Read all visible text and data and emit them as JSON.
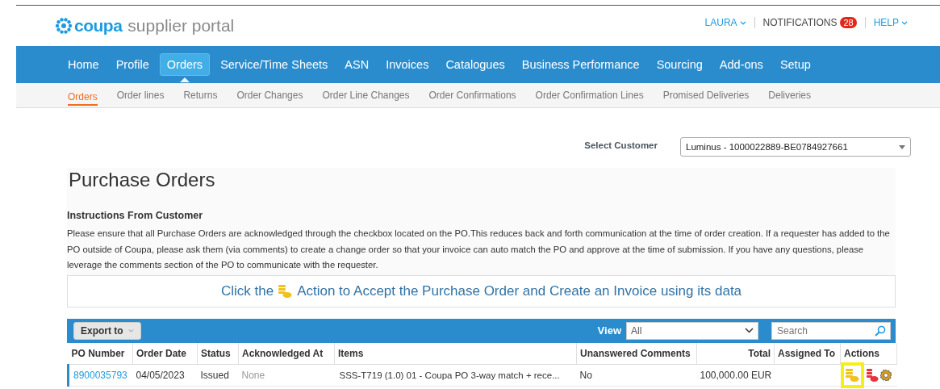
{
  "header": {
    "logo": {
      "brand": "coupa",
      "product": "supplier portal"
    },
    "user_menu": "LAURA",
    "notifications": {
      "label": "NOTIFICATIONS",
      "count": "28"
    },
    "help": "HELP"
  },
  "nav": [
    {
      "label": "Home",
      "selected": false
    },
    {
      "label": "Profile",
      "selected": false
    },
    {
      "label": "Orders",
      "selected": true
    },
    {
      "label": "Service/Time Sheets",
      "selected": false
    },
    {
      "label": "ASN",
      "selected": false
    },
    {
      "label": "Invoices",
      "selected": false
    },
    {
      "label": "Catalogues",
      "selected": false
    },
    {
      "label": "Business Performance",
      "selected": false
    },
    {
      "label": "Sourcing",
      "selected": false
    },
    {
      "label": "Add-ons",
      "selected": false
    },
    {
      "label": "Setup",
      "selected": false
    }
  ],
  "subnav": [
    {
      "label": "Orders",
      "selected": true
    },
    {
      "label": "Order lines",
      "selected": false
    },
    {
      "label": "Returns",
      "selected": false
    },
    {
      "label": "Order Changes",
      "selected": false
    },
    {
      "label": "Order Line Changes",
      "selected": false
    },
    {
      "label": "Order Confirmations",
      "selected": false
    },
    {
      "label": "Order Confirmation Lines",
      "selected": false
    },
    {
      "label": "Promised Deliveries",
      "selected": false
    },
    {
      "label": "Deliveries",
      "selected": false
    }
  ],
  "select_customer": {
    "label": "Select Customer",
    "value": "Luminus - 1000022889-BE0784927661"
  },
  "page_title": "Purchase Orders",
  "instructions": {
    "heading": "Instructions From Customer",
    "text": "Please ensure that all Purchase Orders are acknowledged through the checkbox located on the PO.This reduces back and forth communication at the time of order creation. If a requester has added to the PO outside of Coupa, please ask them (via comments) to create a change order so that your invoice can auto match the PO and approve at the time of submission. If you have any questions, please leverage the comments section of the PO to communicate with the requester."
  },
  "banner": {
    "before": "Click the",
    "after": "Action to Accept the Purchase Order and Create an Invoice using its data"
  },
  "table": {
    "toolbar": {
      "export": "Export to",
      "view_label": "View",
      "view_value": "All",
      "search_placeholder": "Search"
    },
    "columns": [
      "PO Number",
      "Order Date",
      "Status",
      "Acknowledged At",
      "Items",
      "Unanswered Comments",
      "Total",
      "Assigned To",
      "Actions"
    ],
    "rows": [
      {
        "selected": true,
        "po_number": "8900035793",
        "order_date": "04/05/2023",
        "status": "Issued",
        "acknowledged_at": "None",
        "items": "SSS-T719 (1.0) 01 - Coupa PO 3-way match + rece...",
        "unanswered_comments": "No",
        "total": "100,000.00 EUR",
        "actions": [
          {
            "kind": "invoice",
            "highlighted": true
          },
          {
            "kind": "invoice-red",
            "highlighted": false
          },
          {
            "kind": "settings",
            "highlighted": false
          }
        ]
      }
    ]
  }
}
